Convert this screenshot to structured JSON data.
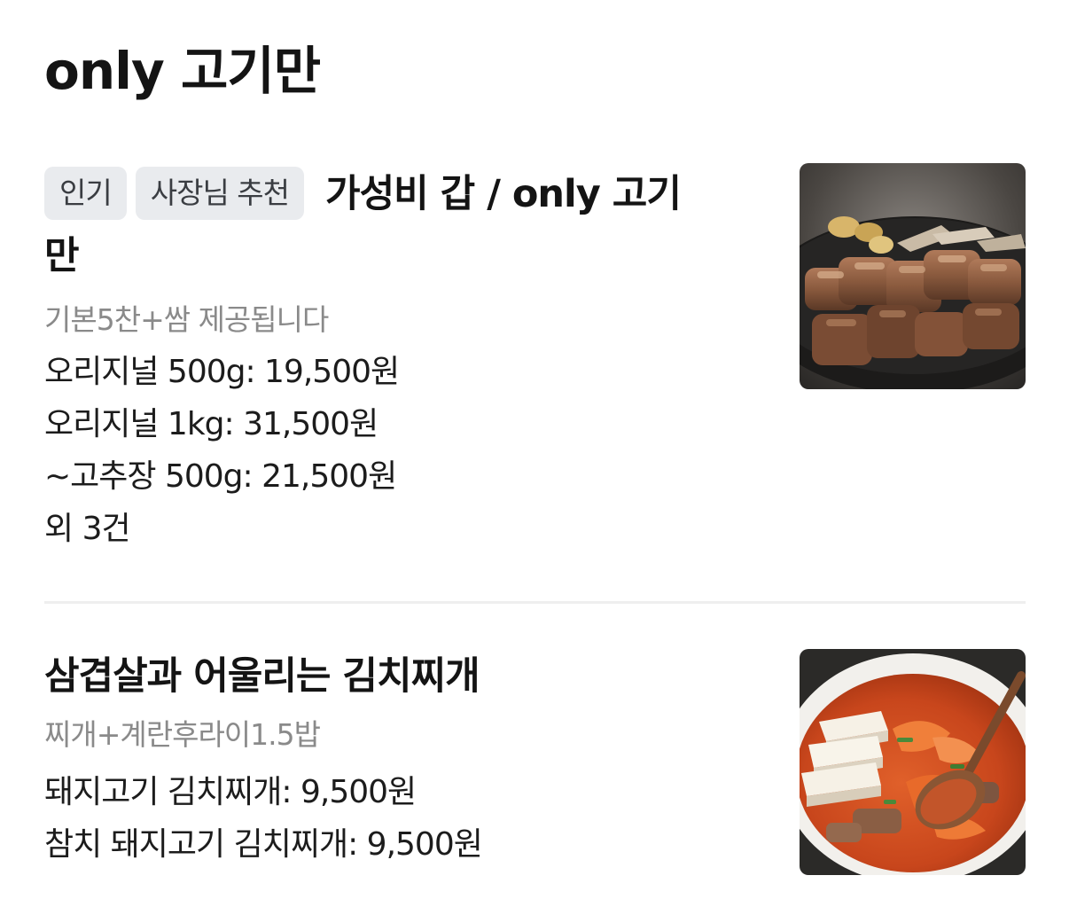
{
  "section": {
    "title": "only 고기만"
  },
  "items": [
    {
      "badges": [
        "인기",
        "사장님 추천"
      ],
      "name": "가성비 갑 / only 고기만",
      "description": "기본5찬+쌈 제공됩니다",
      "prices": [
        "오리지널 500g: 19,500원",
        "오리지널 1kg: 31,500원",
        "~고추장 500g: 21,500원",
        "외 3건"
      ],
      "image": "grilled-pork-photo"
    },
    {
      "badges": [],
      "name": "삼겹살과 어울리는 김치찌개",
      "description": "찌개+계란후라이1.5밥",
      "prices": [
        "돼지고기 김치찌개: 9,500원",
        "참치 돼지고기 김치찌개: 9,500원"
      ],
      "image": "kimchi-stew-photo"
    }
  ]
}
